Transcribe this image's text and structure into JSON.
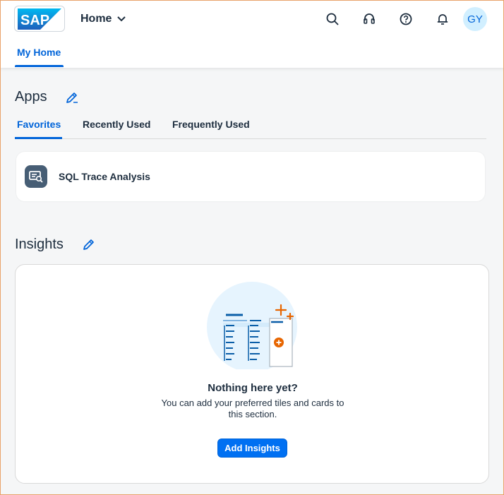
{
  "header": {
    "logo_text": "SAP",
    "home_menu_label": "Home",
    "avatar_initials": "GY",
    "icons": [
      "search-icon",
      "headset-icon",
      "help-icon",
      "bell-icon"
    ]
  },
  "page_tabs": [
    {
      "label": "My Home",
      "active": true
    }
  ],
  "apps": {
    "title": "Apps",
    "tabs": [
      {
        "label": "Favorites",
        "active": true
      },
      {
        "label": "Recently Used",
        "active": false
      },
      {
        "label": "Frequently Used",
        "active": false
      }
    ],
    "tiles": [
      {
        "label": "SQL Trace Analysis",
        "icon": "sql-trace-icon"
      }
    ]
  },
  "insights": {
    "title": "Insights",
    "empty_title": "Nothing here yet?",
    "empty_description": "You can add your preferred tiles and cards to this section.",
    "add_button_label": "Add Insights"
  },
  "colors": {
    "accent": "#0064d9",
    "button": "#0070f2",
    "text": "#1d2d3e",
    "background": "#f5f6f7",
    "highlight_orange": "#e76500"
  }
}
